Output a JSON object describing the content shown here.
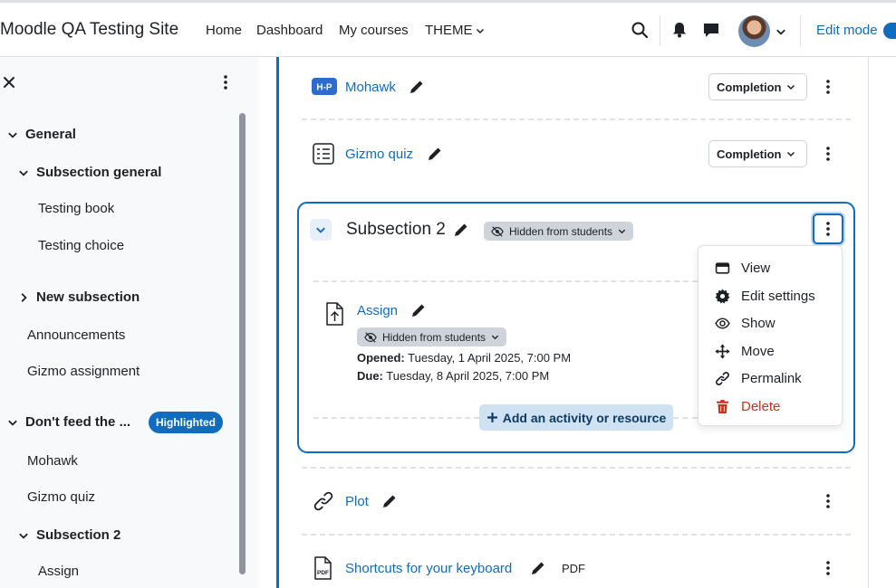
{
  "navbar": {
    "site_name": "Moodle QA Testing Site",
    "links": [
      "Home",
      "Dashboard",
      "My courses",
      "THEME"
    ],
    "edit_mode_label": "Edit mode"
  },
  "course_index": {
    "items": [
      {
        "label": "General",
        "level": 0,
        "bold": true,
        "chevron": "down"
      },
      {
        "label": "Subsection general",
        "level": 1,
        "bold": true,
        "chevron": "down"
      },
      {
        "label": "Testing book",
        "level": 2
      },
      {
        "label": "Testing choice",
        "level": 2
      },
      {
        "label": "New subsection",
        "level": 1,
        "bold": true,
        "chevron": "right"
      },
      {
        "label": "Announcements",
        "level": 1
      },
      {
        "label": "Gizmo assignment",
        "level": 1
      },
      {
        "label": "Don't feed the ...",
        "level": 0,
        "bold": true,
        "chevron": "down"
      },
      {
        "label": "Mohawk",
        "level": 1
      },
      {
        "label": "Gizmo quiz",
        "level": 1
      },
      {
        "label": "Subsection 2",
        "level": 1,
        "bold": true,
        "chevron": "down"
      },
      {
        "label": "Assign",
        "level": 2
      }
    ],
    "highlighted_badge": "Highlighted"
  },
  "activities": {
    "mohawk": {
      "name": "Mohawk",
      "completion": "Completion"
    },
    "gizmo_quiz": {
      "name": "Gizmo quiz",
      "completion": "Completion"
    },
    "plot": {
      "name": "Plot"
    },
    "shortcuts": {
      "name": "Shortcuts for your keyboard",
      "type_label": "PDF"
    }
  },
  "subsection": {
    "title": "Subsection 2",
    "visibility": "Hidden from students",
    "assign": {
      "name": "Assign",
      "visibility": "Hidden from students",
      "opened_label": "Opened:",
      "opened_value": "Tuesday, 1 April 2025, 7:00 PM",
      "due_label": "Due:",
      "due_value": "Tuesday, 8 April 2025, 7:00 PM"
    },
    "add_activity": "Add an activity or resource"
  },
  "menu": {
    "items": [
      {
        "label": "View",
        "icon": "view-icon"
      },
      {
        "label": "Edit settings",
        "icon": "gear-icon"
      },
      {
        "label": "Show",
        "icon": "eye-icon"
      },
      {
        "label": "Move",
        "icon": "move-icon"
      },
      {
        "label": "Permalink",
        "icon": "link-icon"
      },
      {
        "label": "Delete",
        "icon": "trash-icon"
      }
    ]
  },
  "colors": {
    "primary": "#0f6cbf",
    "danger": "#ca3120",
    "highlight_badge": "#0f6cbf",
    "hidden_badge": "#ced4da"
  }
}
